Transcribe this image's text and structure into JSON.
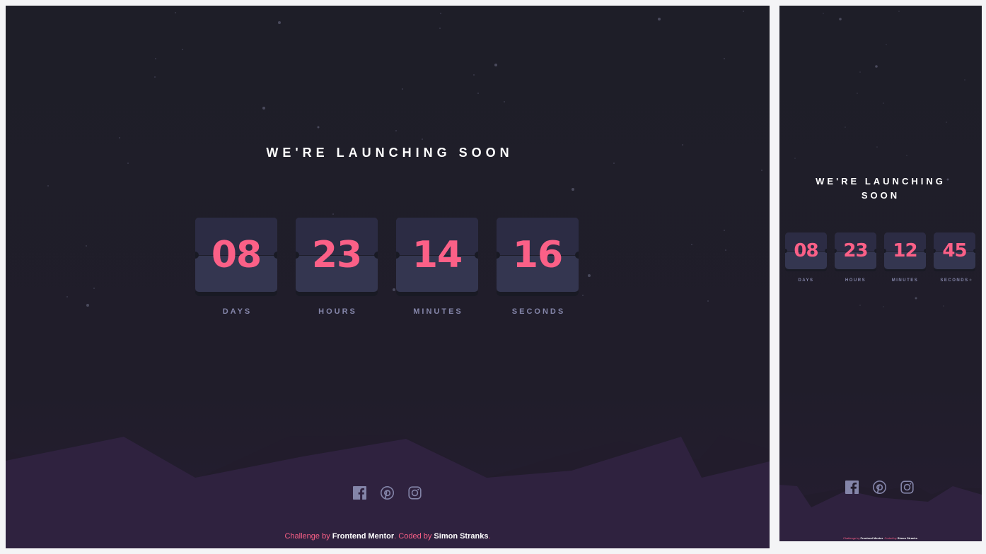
{
  "headline": "WE'RE LAUNCHING SOON",
  "colors": {
    "background": "#1e1e28",
    "card": "#343650",
    "card_top": "#2c2c44",
    "digits": "#fb6087",
    "labels": "#8485a9",
    "hills": "#2f223f",
    "white": "#ffffff"
  },
  "desktop": {
    "countdown": [
      {
        "value": "08",
        "label": "DAYS"
      },
      {
        "value": "23",
        "label": "HOURS"
      },
      {
        "value": "14",
        "label": "MINUTES"
      },
      {
        "value": "16",
        "label": "SECONDS"
      }
    ]
  },
  "mobile": {
    "headline": "WE'RE LAUNCHING SOON",
    "countdown": [
      {
        "value": "08",
        "label": "DAYS"
      },
      {
        "value": "23",
        "label": "HOURS"
      },
      {
        "value": "12",
        "label": "MINUTES"
      },
      {
        "value": "45",
        "label": "SECONDS"
      }
    ]
  },
  "social": [
    {
      "name": "facebook",
      "icon": "facebook-icon"
    },
    {
      "name": "pinterest",
      "icon": "pinterest-icon"
    },
    {
      "name": "instagram",
      "icon": "instagram-icon"
    }
  ],
  "attribution": {
    "challenge_prefix": "Challenge by",
    "challenge_link": "Frontend Mentor",
    "coded_prefix": ". Coded by",
    "coded_link": "Simon Stranks",
    "suffix": "."
  }
}
